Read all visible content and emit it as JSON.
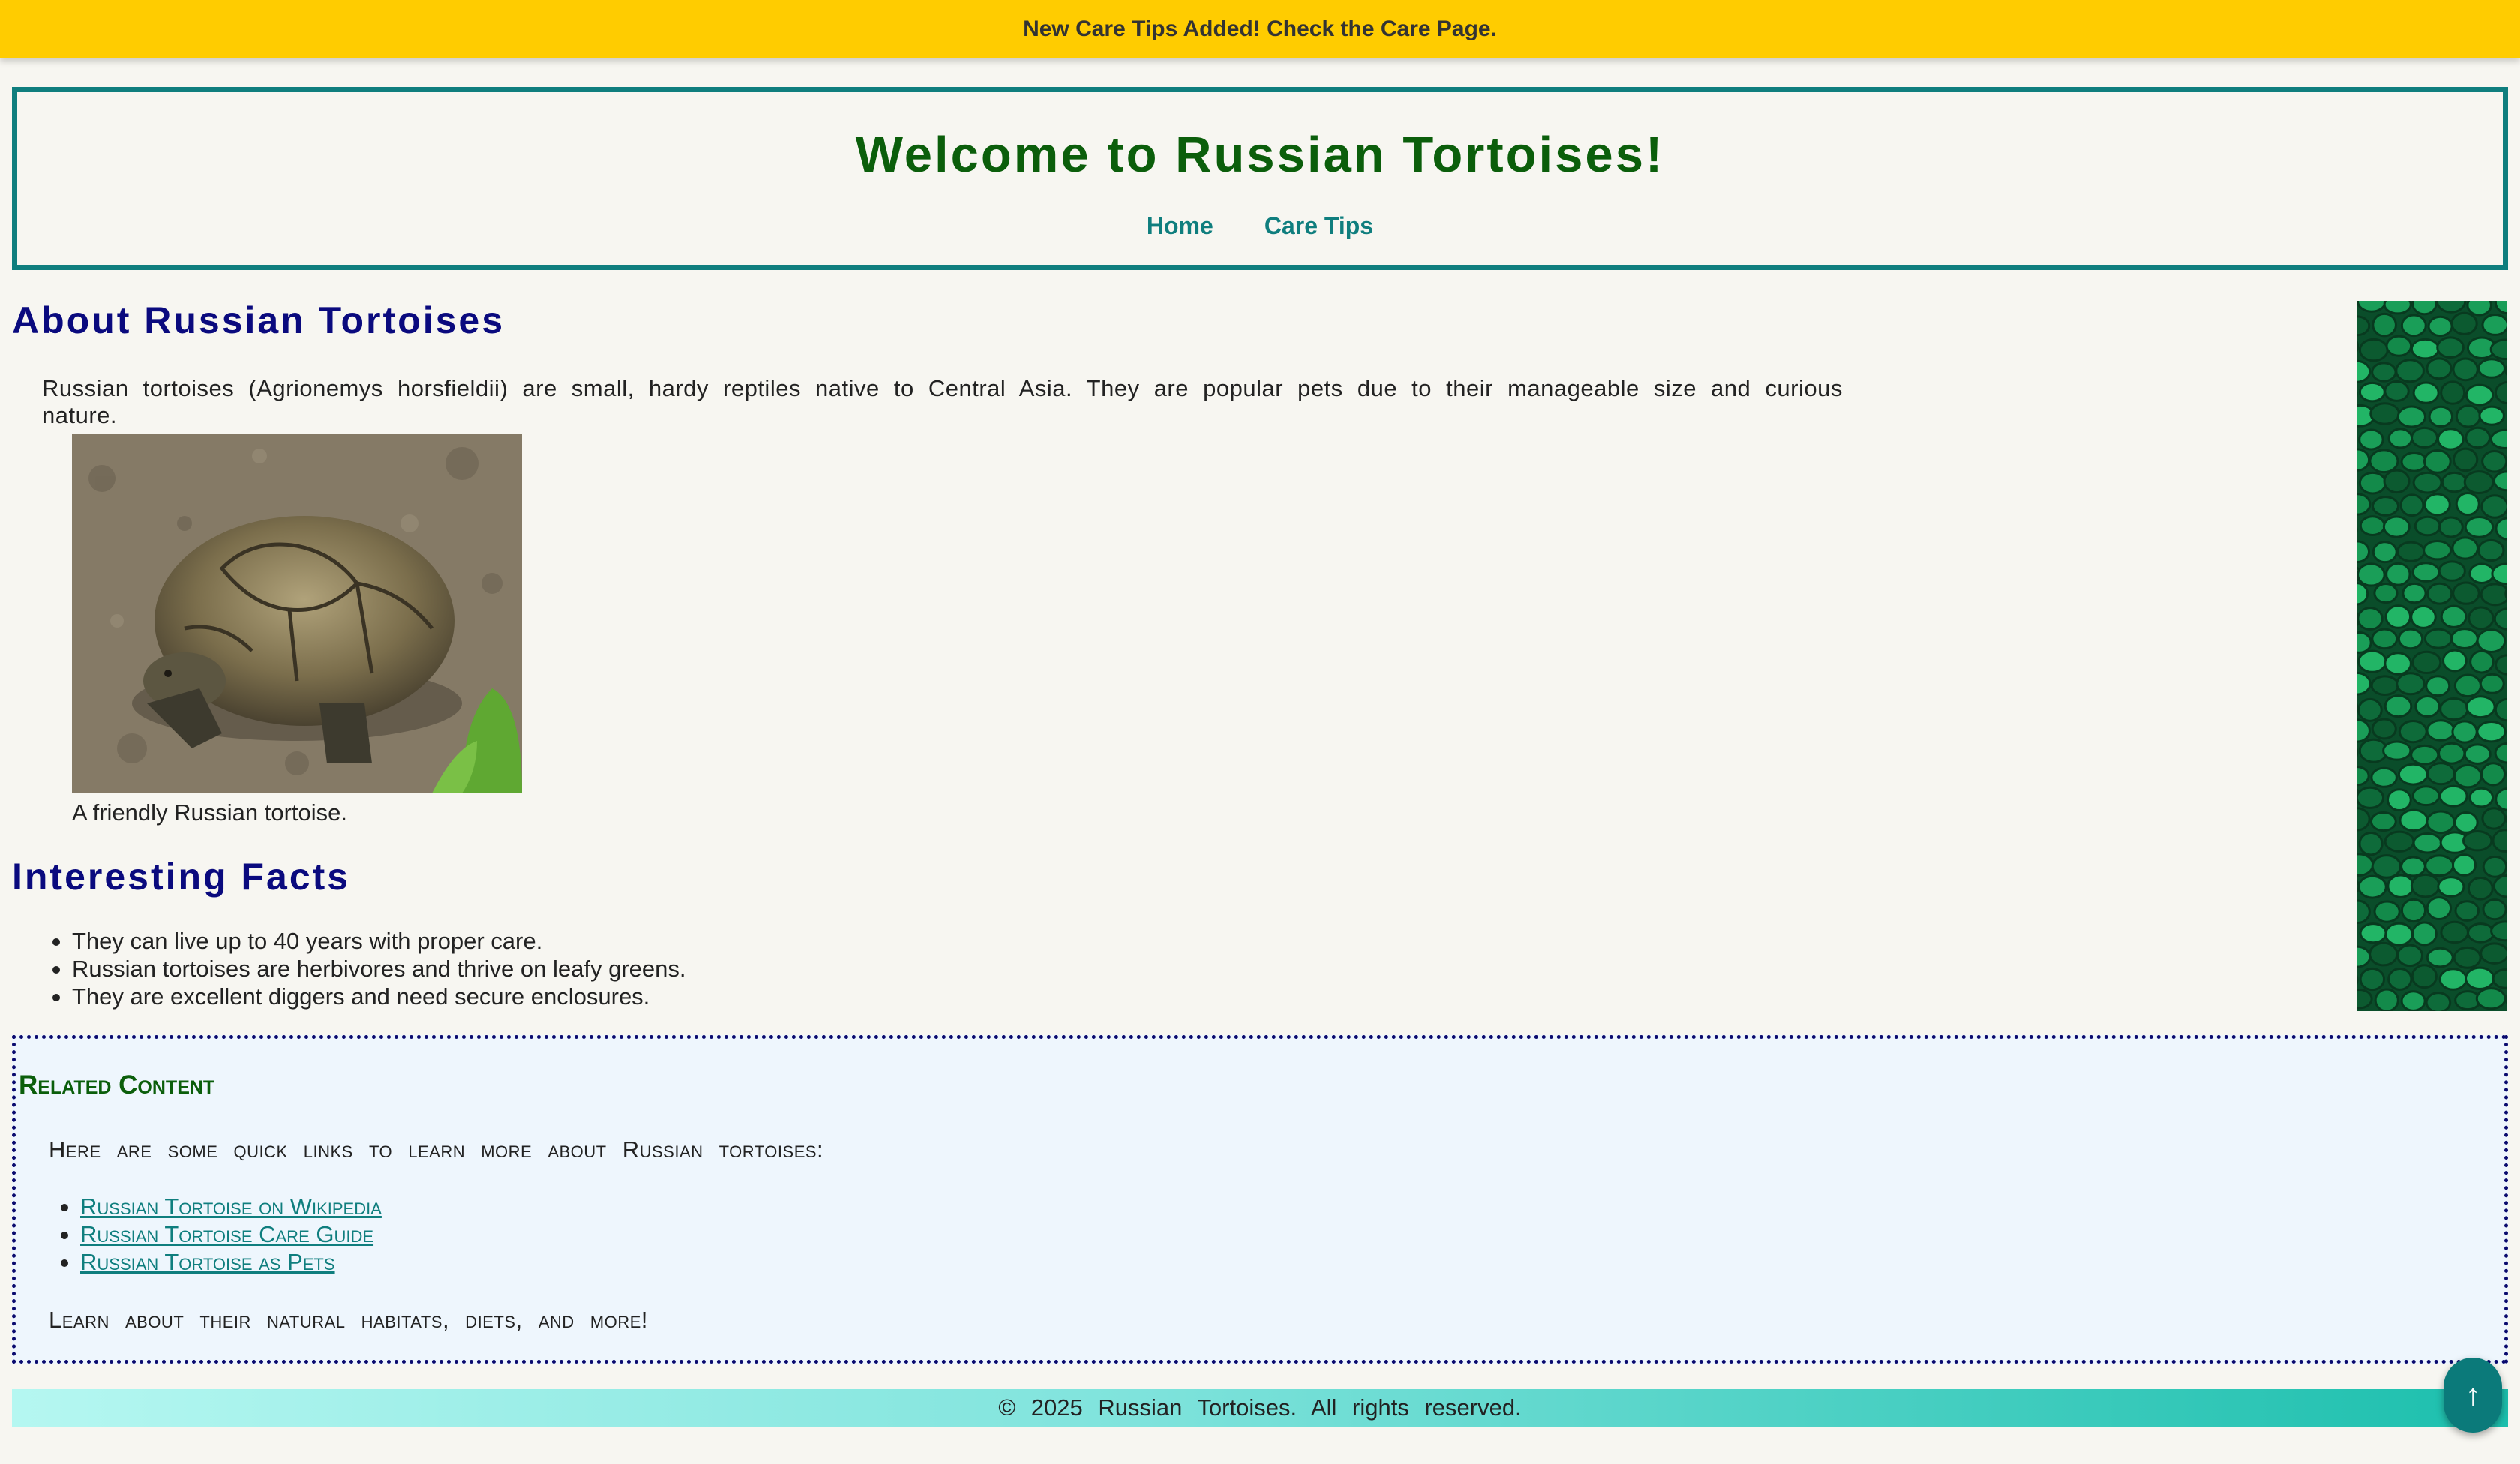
{
  "banner": {
    "text": "New Care Tips Added! Check the Care Page."
  },
  "header": {
    "title": "Welcome to Russian Tortoises!",
    "nav": [
      {
        "label": "Home"
      },
      {
        "label": "Care Tips"
      }
    ]
  },
  "about": {
    "heading": "About Russian Tortoises",
    "text": "Russian tortoises (Agrionemys horsfieldii) are small, hardy reptiles native to Central Asia. They are popular pets due to their manageable size and curious nature.",
    "caption": "A friendly Russian tortoise."
  },
  "facts": {
    "heading": "Interesting Facts",
    "items": [
      "They can live up to 40 years with proper care.",
      "Russian tortoises are herbivores and thrive on leafy greens.",
      "They are excellent diggers and need secure enclosures."
    ]
  },
  "related": {
    "heading": "Related Content",
    "intro": "Here are some quick links to learn more about Russian tortoises:",
    "links": [
      "Russian Tortoise on Wikipedia",
      "Russian Tortoise Care Guide",
      "Russian Tortoise as Pets"
    ],
    "outro": "Learn about their natural habitats, diets, and more!"
  },
  "footer": {
    "text": "© 2025 Russian Tortoises. All rights reserved."
  },
  "back_to_top": {
    "icon": "arrow-up-icon",
    "glyph": "↑"
  },
  "colors": {
    "banner": "#ffcc00",
    "teal": "#0f7e7e",
    "title_green": "#0b5e0b",
    "heading_navy": "#0a0a7e",
    "page_bg": "#f7f6f1"
  }
}
